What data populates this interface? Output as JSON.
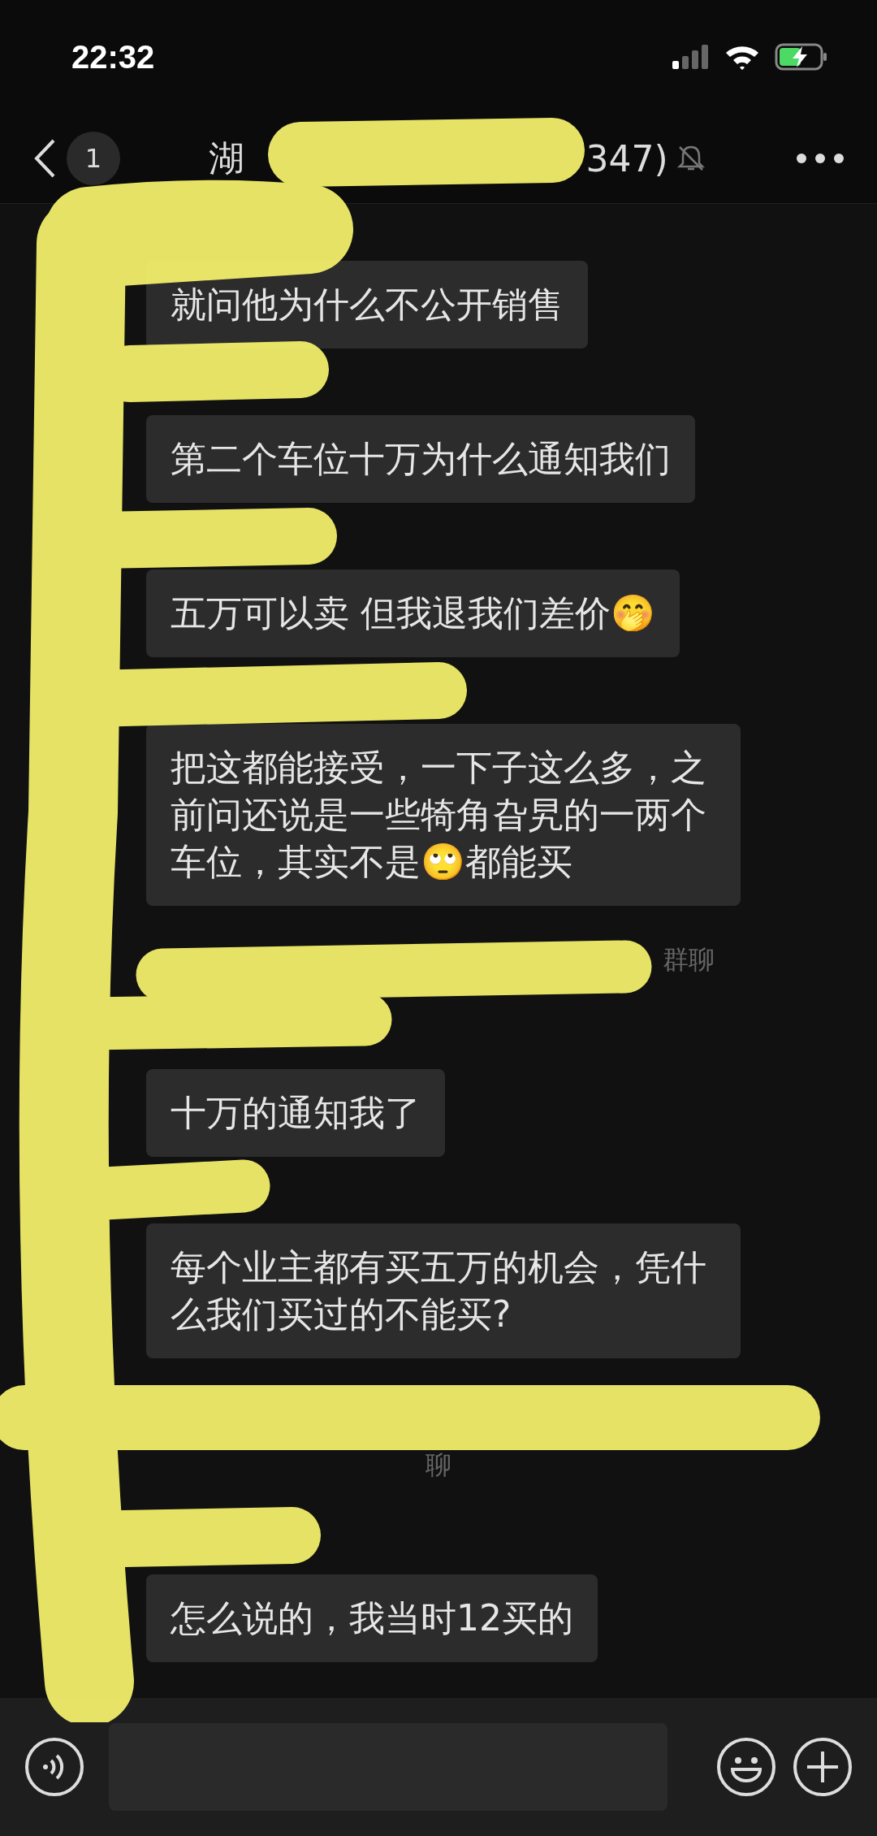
{
  "status_bar": {
    "time": "22:32"
  },
  "header": {
    "unread_count": "1",
    "title_start": "湖",
    "title_end": "347)",
    "muted": true
  },
  "chat": [
    {
      "kind": "message",
      "text": "就问他为什么不公开销售"
    },
    {
      "kind": "message",
      "text": "第二个车位十万为什么通知我们"
    },
    {
      "kind": "message",
      "text": "五万可以卖 但我退我们差价🤭"
    },
    {
      "kind": "message",
      "text": "把这都能接受，一下子这么多，之前问还说是一些犄角旮旯的一两个车位，其实不是🙄都能买"
    },
    {
      "kind": "notice",
      "text": "群聊"
    },
    {
      "kind": "message",
      "text": "十万的通知我了"
    },
    {
      "kind": "message",
      "text": "每个业主都有买五万的机会，凭什么我们买过的不能买?"
    },
    {
      "kind": "notice",
      "text": "聊"
    },
    {
      "kind": "message",
      "text": "怎么说的，我当时12买的"
    }
  ]
}
